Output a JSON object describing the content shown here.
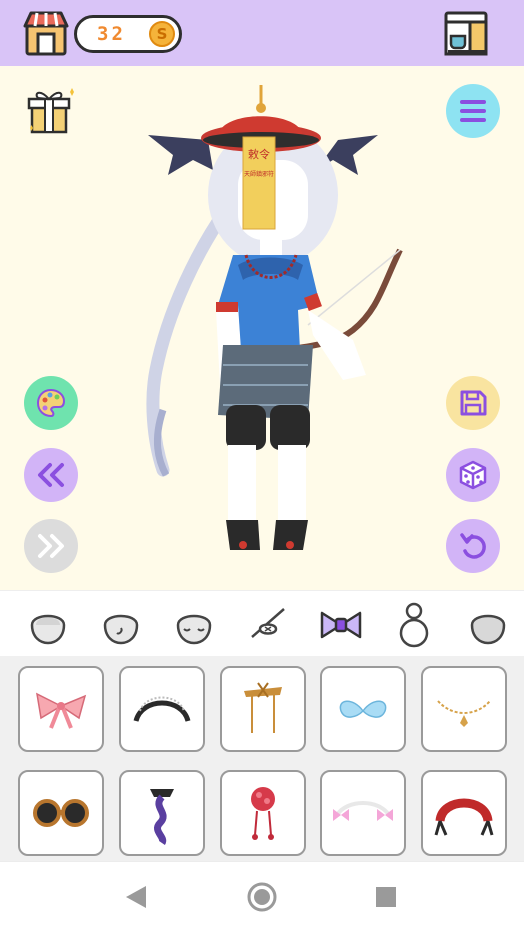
{
  "header": {
    "coin_count": "32",
    "coin_symbol": "S"
  },
  "colors": {
    "header_bg": "#d9c4f7",
    "stage_bg": "#fffbe9",
    "button_purple": "#d2b4f7",
    "button_green": "#6fe3ae",
    "button_gray": "#dcdcdc",
    "button_yellow": "#f9e4a0",
    "button_blue": "#8ee3f2",
    "accent_purple": "#8b4fe0"
  },
  "icons": {
    "shop": "shop-icon",
    "coin": "coin-icon",
    "kitchen": "kitchen-icon",
    "gift": "gift-icon",
    "menu": "menu-icon",
    "palette": "palette-icon",
    "undo_all": "double-chevron-left-icon",
    "redo_all": "double-chevron-right-icon",
    "save": "floppy-disk-icon",
    "random": "dice-icon",
    "reset": "undo-icon"
  },
  "categories": [
    {
      "name": "head-base",
      "selected": false
    },
    {
      "name": "ear",
      "selected": false
    },
    {
      "name": "eyes",
      "selected": false
    },
    {
      "name": "eyepatch",
      "selected": false
    },
    {
      "name": "bow-accessory",
      "selected": true
    },
    {
      "name": "body",
      "selected": false
    },
    {
      "name": "head-back",
      "selected": false
    }
  ],
  "items": [
    {
      "name": "pink-bow"
    },
    {
      "name": "black-headband"
    },
    {
      "name": "wooden-hairpin"
    },
    {
      "name": "blue-ribbon"
    },
    {
      "name": "gold-necklace"
    },
    {
      "name": "goggles"
    },
    {
      "name": "purple-ribbon-pin"
    },
    {
      "name": "red-flower-ornament"
    },
    {
      "name": "pink-bow-garland"
    },
    {
      "name": "red-rose-headband"
    }
  ],
  "talisman": {
    "line1": "敕令",
    "line2": "天師鎮邪符"
  }
}
